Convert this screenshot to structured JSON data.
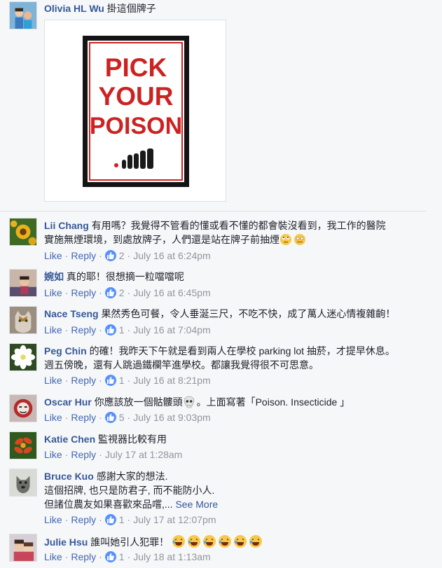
{
  "post": {
    "author": "Olivia HL Wu",
    "text": "掛這個牌子",
    "sign": {
      "line1": "PICK",
      "line2": "YOUR",
      "line3": "POISON"
    }
  },
  "actions": {
    "like": "Like",
    "reply": "Reply"
  },
  "comments": [
    {
      "name": "Lii Chang",
      "line1": "有用嗎？我覺得不管看的懂或看不懂的都會裝沒看到，我工作的醫院",
      "line2": "實施無煙環境，到處放牌子，人們還是站在牌子前抽煙",
      "likes": "2",
      "time": "July 16 at 6:24pm"
    },
    {
      "name": "婉如",
      "line1": "真的耶！很想摘一粒噹噹呢",
      "likes": "2",
      "time": "July 16 at 6:45pm"
    },
    {
      "name": "Nace Tseng",
      "line1": "果然秀色可餐，令人垂涎三尺，不吃不快，成了萬人迷心情複雜齣！",
      "likes": "1",
      "time": "July 16 at 7:04pm"
    },
    {
      "name": "Peg Chin",
      "line1": "的確！我昨天下午就是看到兩人在學校 parking lot 抽菸，才提早休息。",
      "line2": "週五傍晚，還有人跳過鐵欄竿進學校。都讓我覺得很不可思意。",
      "likes": "1",
      "time": "July 16 at 8:21pm"
    },
    {
      "name": "Oscar Hur",
      "line1a": "你應該放一個骷髏頭",
      "line1b": "。上面寫著「Poison. Insecticide 」",
      "likes": "5",
      "time": "July 16 at 9:03pm"
    },
    {
      "name": "Katie Chen",
      "line1": "監視器比較有用",
      "time": "July 17 at 1:28am"
    },
    {
      "name": "Bruce Kuo",
      "line1": "感謝大家的想法.",
      "line2": "這個招牌, 也只是防君子, 而不能防小人.",
      "line3": "但諸位農友如果喜歡來品嚐,...",
      "see_more": "See More",
      "likes": "1",
      "time": "July 17 at 12:07pm"
    },
    {
      "name": "Julie Hsu",
      "line1": "誰叫她引人犯罪！",
      "likes": "1",
      "time": "July 18 at 1:13am"
    }
  ]
}
